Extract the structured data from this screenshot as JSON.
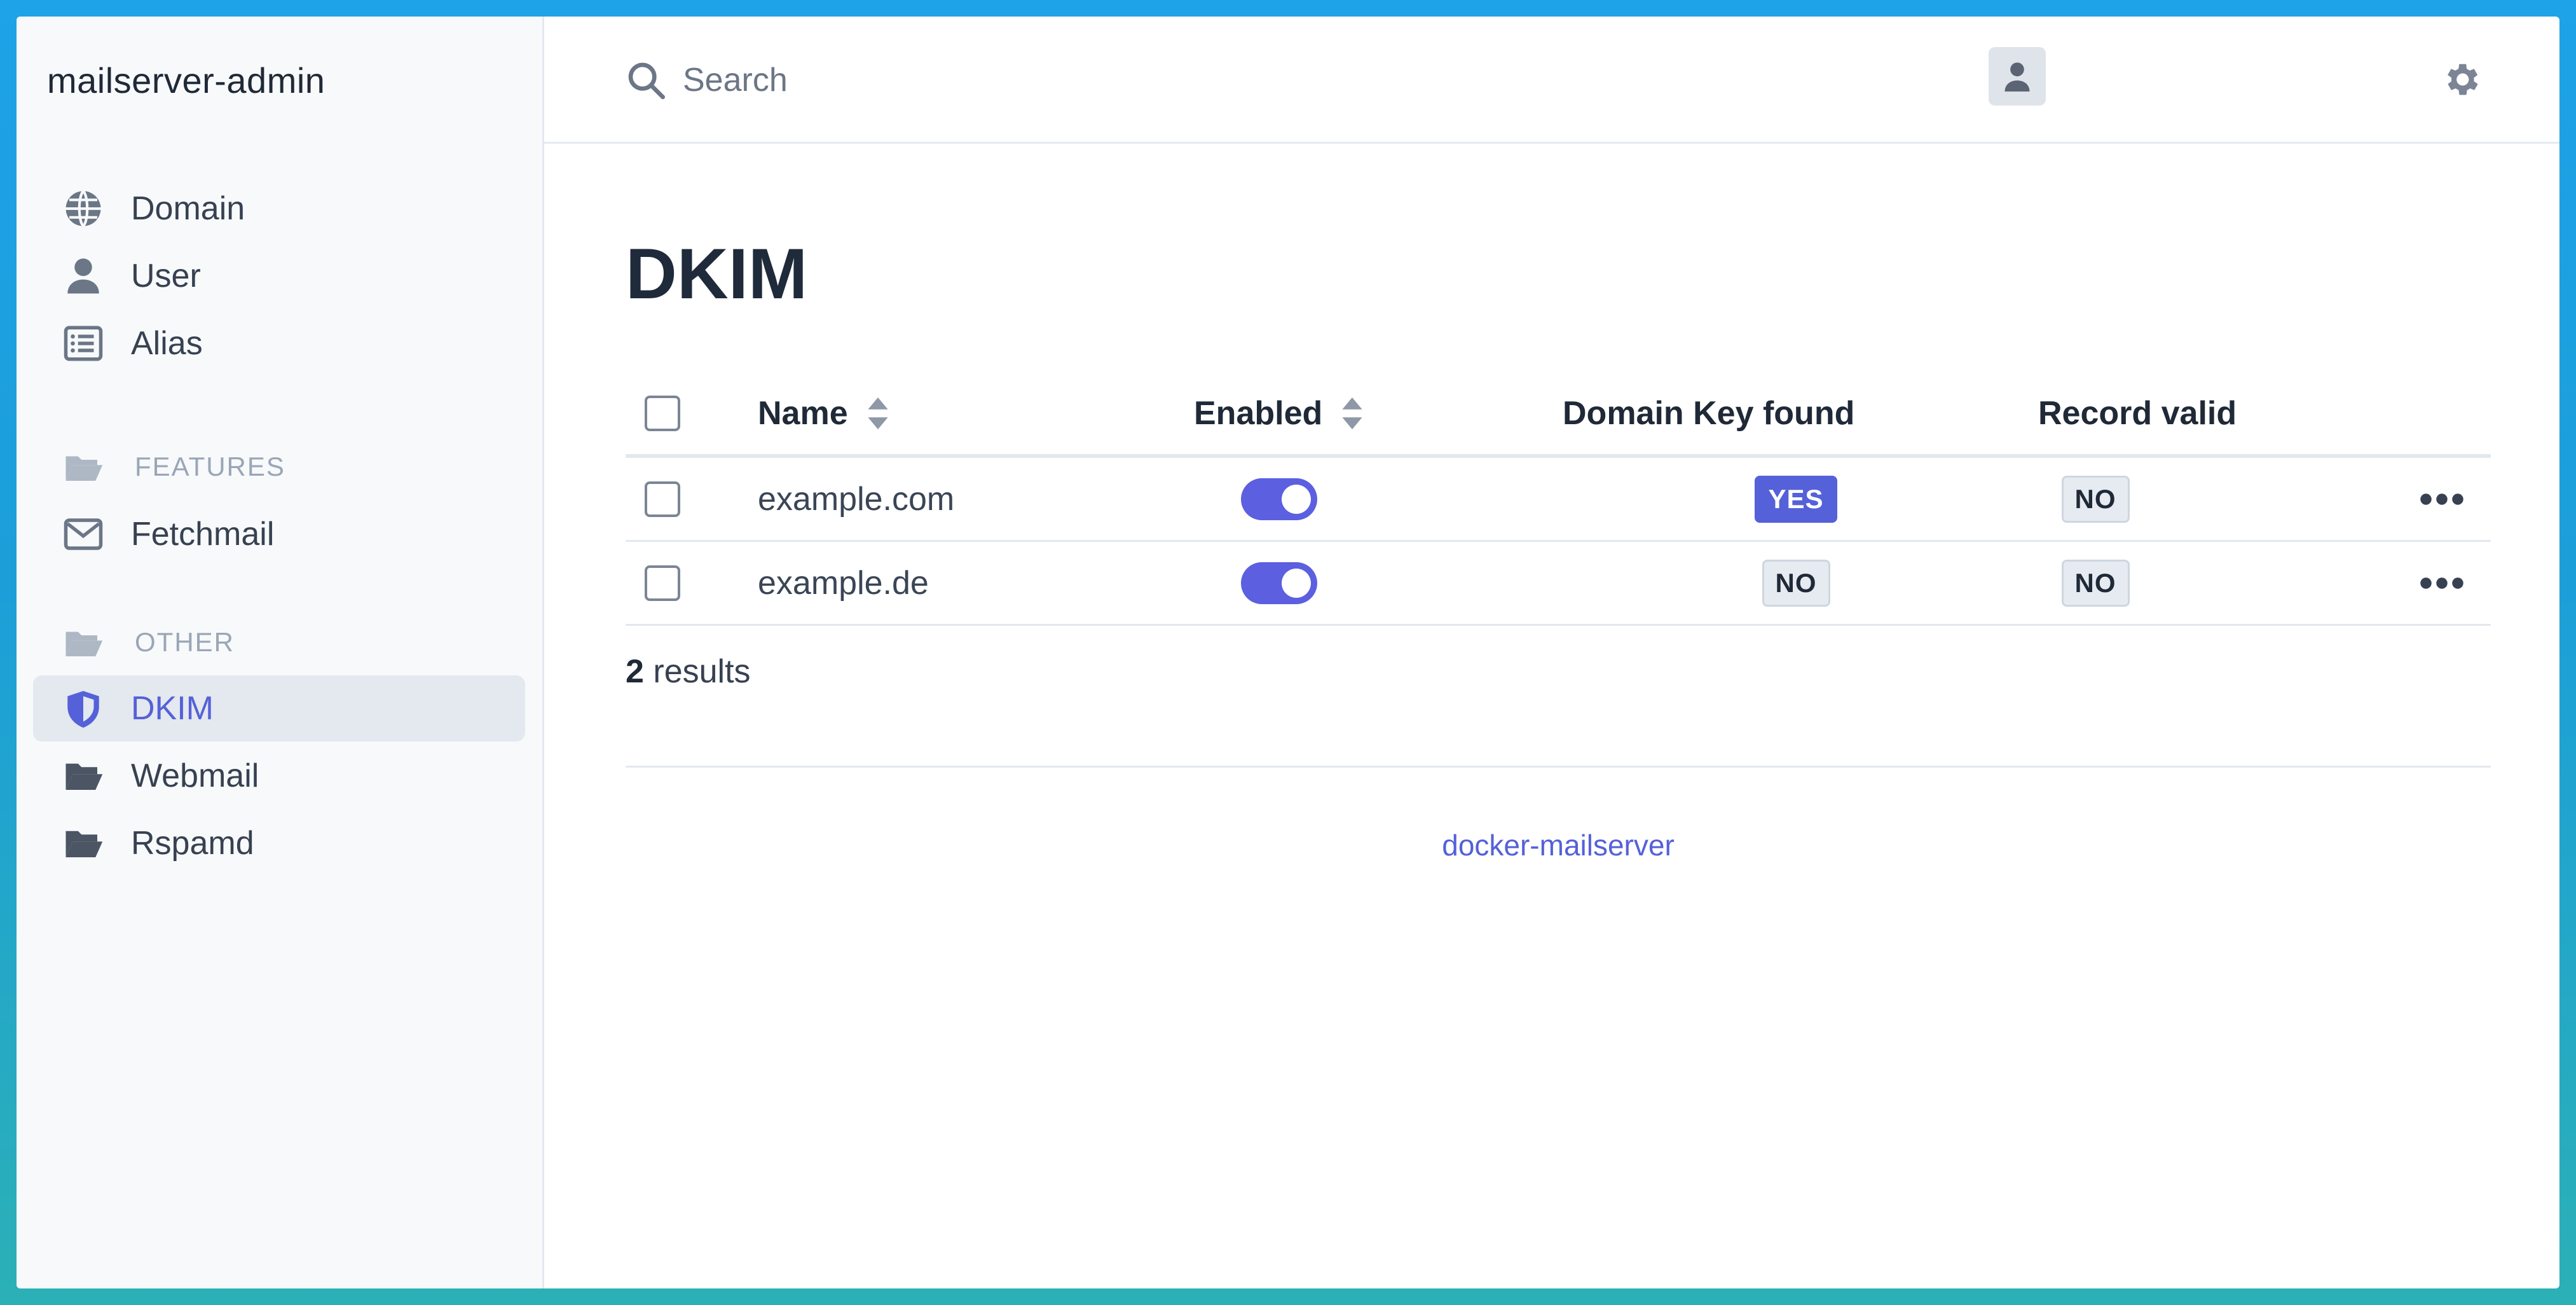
{
  "app": {
    "title": "mailserver-admin"
  },
  "sidebar": {
    "items": [
      {
        "label": "Domain",
        "icon": "globe-icon"
      },
      {
        "label": "User",
        "icon": "user-icon"
      },
      {
        "label": "Alias",
        "icon": "list-icon"
      }
    ],
    "sections": [
      {
        "label": "FEATURES",
        "items": [
          {
            "label": "Fetchmail",
            "icon": "envelope-icon"
          }
        ]
      },
      {
        "label": "OTHER",
        "items": [
          {
            "label": "DKIM",
            "icon": "shield-icon",
            "active": true
          },
          {
            "label": "Webmail",
            "icon": "folder-open-icon"
          },
          {
            "label": "Rspamd",
            "icon": "folder-open-icon"
          }
        ]
      }
    ]
  },
  "header": {
    "search": {
      "placeholder": "Search",
      "value": ""
    }
  },
  "main": {
    "title": "DKIM",
    "table": {
      "columns": [
        "Name",
        "Enabled",
        "Domain Key found",
        "Record valid"
      ],
      "rows": [
        {
          "name": "example.com",
          "enabled": true,
          "domain_key_found": "YES",
          "record_valid": "NO"
        },
        {
          "name": "example.de",
          "enabled": true,
          "domain_key_found": "NO",
          "record_valid": "NO"
        }
      ]
    },
    "results": {
      "count": "2",
      "label": "results"
    }
  },
  "footer": {
    "link": "docker-mailserver"
  },
  "colors": {
    "accent": "#5561d8",
    "toggle_on": "#5b5fe0",
    "sidebar_bg": "#f7f9fb",
    "active_bg": "#e4e8ef"
  }
}
